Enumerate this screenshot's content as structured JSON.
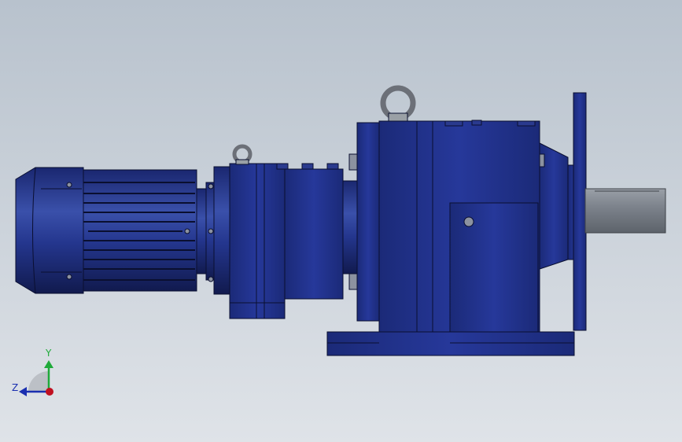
{
  "viewport": {
    "background_top": "#b8c2cd",
    "background_bottom": "#dfe3e8"
  },
  "model": {
    "body_color": "#22338a",
    "body_dark": "#131c55",
    "body_light": "#3e55b0",
    "outline_color": "#0a0f30",
    "shaft_color": "#7d838c",
    "lifting_eye_color": "#9aa0a6"
  },
  "triad": {
    "y_label": "Y",
    "z_label": "Z",
    "y_color": "#1faa3a",
    "z_color": "#1a2fb0",
    "x_color": "#c01020"
  }
}
